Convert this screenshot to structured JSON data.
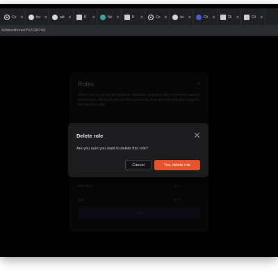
{
  "browser": {
    "tabs": [
      {
        "title": "Co",
        "icon": "github-icon"
      },
      {
        "title": "Inv",
        "icon": "globe-icon"
      },
      {
        "title": "adi",
        "icon": "globe-icon"
      },
      {
        "title": "B",
        "icon": "grid-icon"
      },
      {
        "title": "Ne",
        "icon": "teal-circle-icon"
      },
      {
        "title": "B",
        "icon": "grid-icon"
      },
      {
        "title": "Co",
        "icon": "github-icon"
      },
      {
        "title": "loc",
        "icon": "globe-icon"
      },
      {
        "title": "Ch",
        "icon": "blue-circle-icon"
      },
      {
        "title": "Cli",
        "icon": "grid-icon"
      },
      {
        "title": "Cli",
        "icon": "grid-icon"
      }
    ],
    "close_glyph": "×",
    "url": "/0/inbox/thread/2%7C84749/"
  },
  "roles_panel": {
    "title": "Roles",
    "close_glyph": "×",
    "description": "Roles help you group permissions. Members assigned roles inherit their access permissions. When people join the community, they are automatically assigned the Members role.",
    "rows": [
      {
        "name": "New Role",
        "users": "0 ⚇"
      },
      {
        "name": "test",
        "users": "0 ⚇"
      }
    ],
    "save_label": "Save"
  },
  "modal": {
    "title": "Delete role",
    "message": "Are you sure you want to delete this role?",
    "cancel_label": "Cancel",
    "confirm_label": "Yes, delete role",
    "colors": {
      "confirm": "#e8532e",
      "background": "#1c1c1f"
    }
  }
}
